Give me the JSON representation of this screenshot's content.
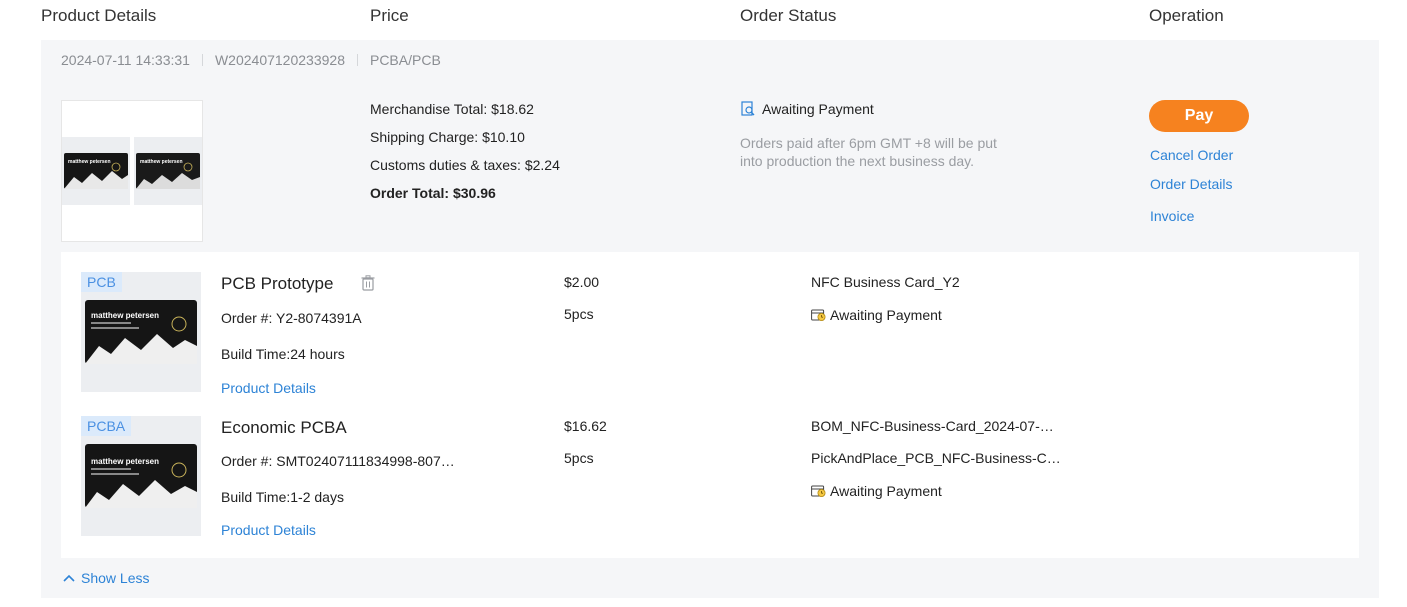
{
  "columns": {
    "product_details": "Product Details",
    "price": "Price",
    "order_status": "Order Status",
    "operation": "Operation"
  },
  "order": {
    "date": "2024-07-11 14:33:31",
    "number": "W202407120233928",
    "category": "PCBA/PCB",
    "price": {
      "merchandise": "Merchandise Total: $18.62",
      "shipping": "Shipping Charge: $10.10",
      "customs": "Customs duties & taxes: $2.24",
      "total": "Order Total: $30.96"
    },
    "status": {
      "label": "Awaiting Payment",
      "icon": "magnifier-document-icon",
      "note": "Orders paid after 6pm GMT +8 will be put into production the next business day."
    },
    "operations": {
      "pay": "Pay",
      "cancel": "Cancel Order",
      "details": "Order Details",
      "invoice": "Invoice"
    },
    "card_text": "matthew petersen"
  },
  "items": [
    {
      "tag": "PCB",
      "name": "PCB Prototype",
      "order_no": "Order #: Y2-8074391A",
      "build_time": "Build Time:24 hours",
      "details_link": "Product Details",
      "price": "$2.00",
      "qty": "5pcs",
      "files": [
        "NFC Business Card_Y2"
      ],
      "status": "Awaiting Payment"
    },
    {
      "tag": "PCBA",
      "name": "Economic PCBA",
      "order_no": "Order #: SMT02407111834998-807…",
      "build_time": "Build Time:1-2 days",
      "details_link": "Product Details",
      "price": "$16.62",
      "qty": "5pcs",
      "files": [
        "BOM_NFC-Business-Card_2024-07-…",
        "PickAndPlace_PCB_NFC-Business-C…"
      ],
      "status": "Awaiting Payment"
    }
  ],
  "show_less": "Show Less",
  "colors": {
    "accent_blue": "#2d83d6",
    "pay_orange": "#f6821f",
    "panel_bg": "#f5f6f8",
    "tag_bg": "#dbeafb"
  }
}
